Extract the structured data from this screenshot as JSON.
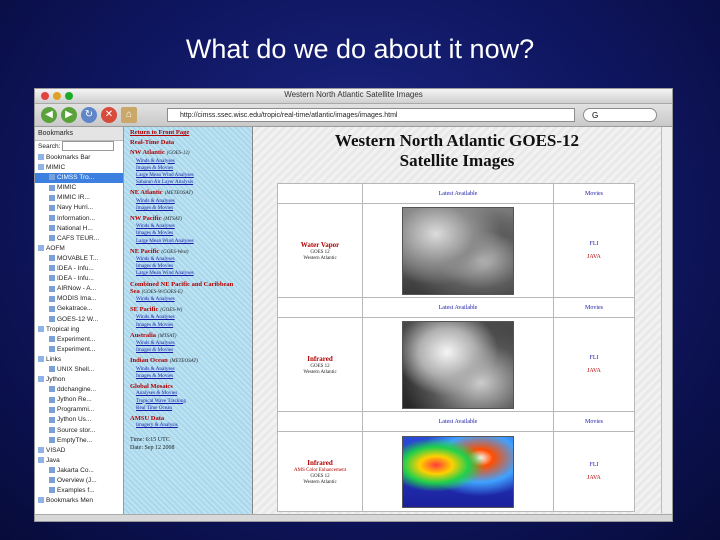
{
  "slide": {
    "title": "What do we do about it now?"
  },
  "window": {
    "title": "Western North Atlantic Satellite Images"
  },
  "toolbar": {
    "url": "http://cimss.ssec.wisc.edu/tropic/real-time/atlantic/images/images.html",
    "search_placeholder": "G"
  },
  "sidebar": {
    "header": "Bookmarks",
    "search_label": "Search:",
    "items": [
      {
        "label": "Bookmarks Bar",
        "indent": 0,
        "selected": false
      },
      {
        "label": "MIMIC",
        "indent": 0,
        "selected": false
      },
      {
        "label": "CIMSS Tro...",
        "indent": 1,
        "selected": true
      },
      {
        "label": "MIMIC",
        "indent": 1,
        "selected": false
      },
      {
        "label": "MIMIC IR...",
        "indent": 1,
        "selected": false
      },
      {
        "label": "Navy Hurri...",
        "indent": 1,
        "selected": false
      },
      {
        "label": "Information...",
        "indent": 1,
        "selected": false
      },
      {
        "label": "National H...",
        "indent": 1,
        "selected": false
      },
      {
        "label": "CAFS TEUR...",
        "indent": 1,
        "selected": false
      },
      {
        "label": "AOFM",
        "indent": 0,
        "selected": false
      },
      {
        "label": "MOVABLE T...",
        "indent": 1,
        "selected": false
      },
      {
        "label": "IDEA - Infu...",
        "indent": 1,
        "selected": false
      },
      {
        "label": "IDEA - Infu...",
        "indent": 1,
        "selected": false
      },
      {
        "label": "AIRNow - A...",
        "indent": 1,
        "selected": false
      },
      {
        "label": "MODIS Ima...",
        "indent": 1,
        "selected": false
      },
      {
        "label": "Gekatrace...",
        "indent": 1,
        "selected": false
      },
      {
        "label": "GOES-12 W...",
        "indent": 1,
        "selected": false
      },
      {
        "label": "Tropical ing",
        "indent": 0,
        "selected": false
      },
      {
        "label": "Experiment...",
        "indent": 1,
        "selected": false
      },
      {
        "label": "Experiment...",
        "indent": 1,
        "selected": false
      },
      {
        "label": "Links",
        "indent": 0,
        "selected": false
      },
      {
        "label": "UNIX Shell...",
        "indent": 1,
        "selected": false
      },
      {
        "label": "Jython",
        "indent": 0,
        "selected": false
      },
      {
        "label": "ddchangine...",
        "indent": 1,
        "selected": false
      },
      {
        "label": "Jython Re...",
        "indent": 1,
        "selected": false
      },
      {
        "label": "Programmi...",
        "indent": 1,
        "selected": false
      },
      {
        "label": "Jython Us...",
        "indent": 1,
        "selected": false
      },
      {
        "label": "Source stor...",
        "indent": 1,
        "selected": false
      },
      {
        "label": "EmptyThe...",
        "indent": 1,
        "selected": false
      },
      {
        "label": "VISAD",
        "indent": 0,
        "selected": false
      },
      {
        "label": "Java",
        "indent": 0,
        "selected": false
      },
      {
        "label": "Jakarta Co...",
        "indent": 1,
        "selected": false
      },
      {
        "label": "Overview (J...",
        "indent": 1,
        "selected": false
      },
      {
        "label": "Examples f...",
        "indent": 1,
        "selected": false
      },
      {
        "label": "Bookmarks Men",
        "indent": 0,
        "selected": false
      }
    ]
  },
  "nav": {
    "top_link": "Return to Front Page",
    "sections": [
      {
        "title": "Real-Time Data",
        "region": "",
        "links": []
      },
      {
        "title": "NW Atlantic",
        "region": "(GOES-12)",
        "links": [
          "Winds & Analyses",
          "Images & Movies",
          "Large Mean Wind Analyses",
          "Saharan Air Layer Analysis"
        ]
      },
      {
        "title": "NE Atlantic",
        "region": "(METEOSAT)",
        "links": [
          "Winds & Analyses",
          "Images & Movies"
        ]
      },
      {
        "title": "NW Pacific",
        "region": "(MTSAT)",
        "links": [
          "Winds & Analyses",
          "Images & Movies",
          "Large Mean Wind Analyses"
        ]
      },
      {
        "title": "NE Pacific",
        "region": "(GOES-West)",
        "links": [
          "Winds & Analyses",
          "Images & Movies",
          "Large Mean Wind Analyses"
        ]
      },
      {
        "title": "Combined NE Pacific and Caribbean Sea",
        "region": "(GOES-W/GOES-E)",
        "links": [
          "Winds & Analyses"
        ]
      },
      {
        "title": "SE Pacific",
        "region": "(GOES-W)",
        "links": [
          "Winds & Analyses",
          "Images & Movies"
        ]
      },
      {
        "title": "Australia",
        "region": "(MTSAT)",
        "links": [
          "Winds & Analyses",
          "Images & Movies"
        ]
      },
      {
        "title": "Indian Ocean",
        "region": "(METEOSAT)",
        "links": [
          "Winds & Analyses",
          "Images & Movies"
        ]
      },
      {
        "title": "Global Mosaics",
        "region": "",
        "links": [
          "Analyses & Movies",
          "Tropical Wave Tracking",
          "Real Time Ocean"
        ]
      },
      {
        "title": "AMSU Data",
        "region": "",
        "links": [
          "Imagery & Analysis"
        ]
      }
    ],
    "time_label": "Time:",
    "time_value": "6:15 UTC",
    "date_label": "Date:",
    "date_value": "Sep 12 2008"
  },
  "page": {
    "heading_line1": "Western North Atlantic GOES-12",
    "heading_line2": "Satellite Images",
    "col_latest": "Latest Available",
    "col_movies": "Movies",
    "rows": [
      {
        "name": "Water Vapor",
        "sat": "GOES 12",
        "area": "Western Atlantic",
        "flash": "FLI",
        "java": "JAVA"
      },
      {
        "name": "Infrared",
        "sat": "GOES 12",
        "area": "Western Atlantic",
        "flash": "FLI",
        "java": "JAVA"
      },
      {
        "name": "Infrared",
        "sat": "GOES 12",
        "area": "Western Atlantic",
        "note": "AMS Color Enhancement",
        "flash": "FLI",
        "java": "JAVA"
      }
    ]
  },
  "colors": {
    "slide_bg": "#0f1660",
    "nav_bg": "#a9d7ec",
    "section_red": "#b00000",
    "link_blue": "#1a1aa8"
  }
}
